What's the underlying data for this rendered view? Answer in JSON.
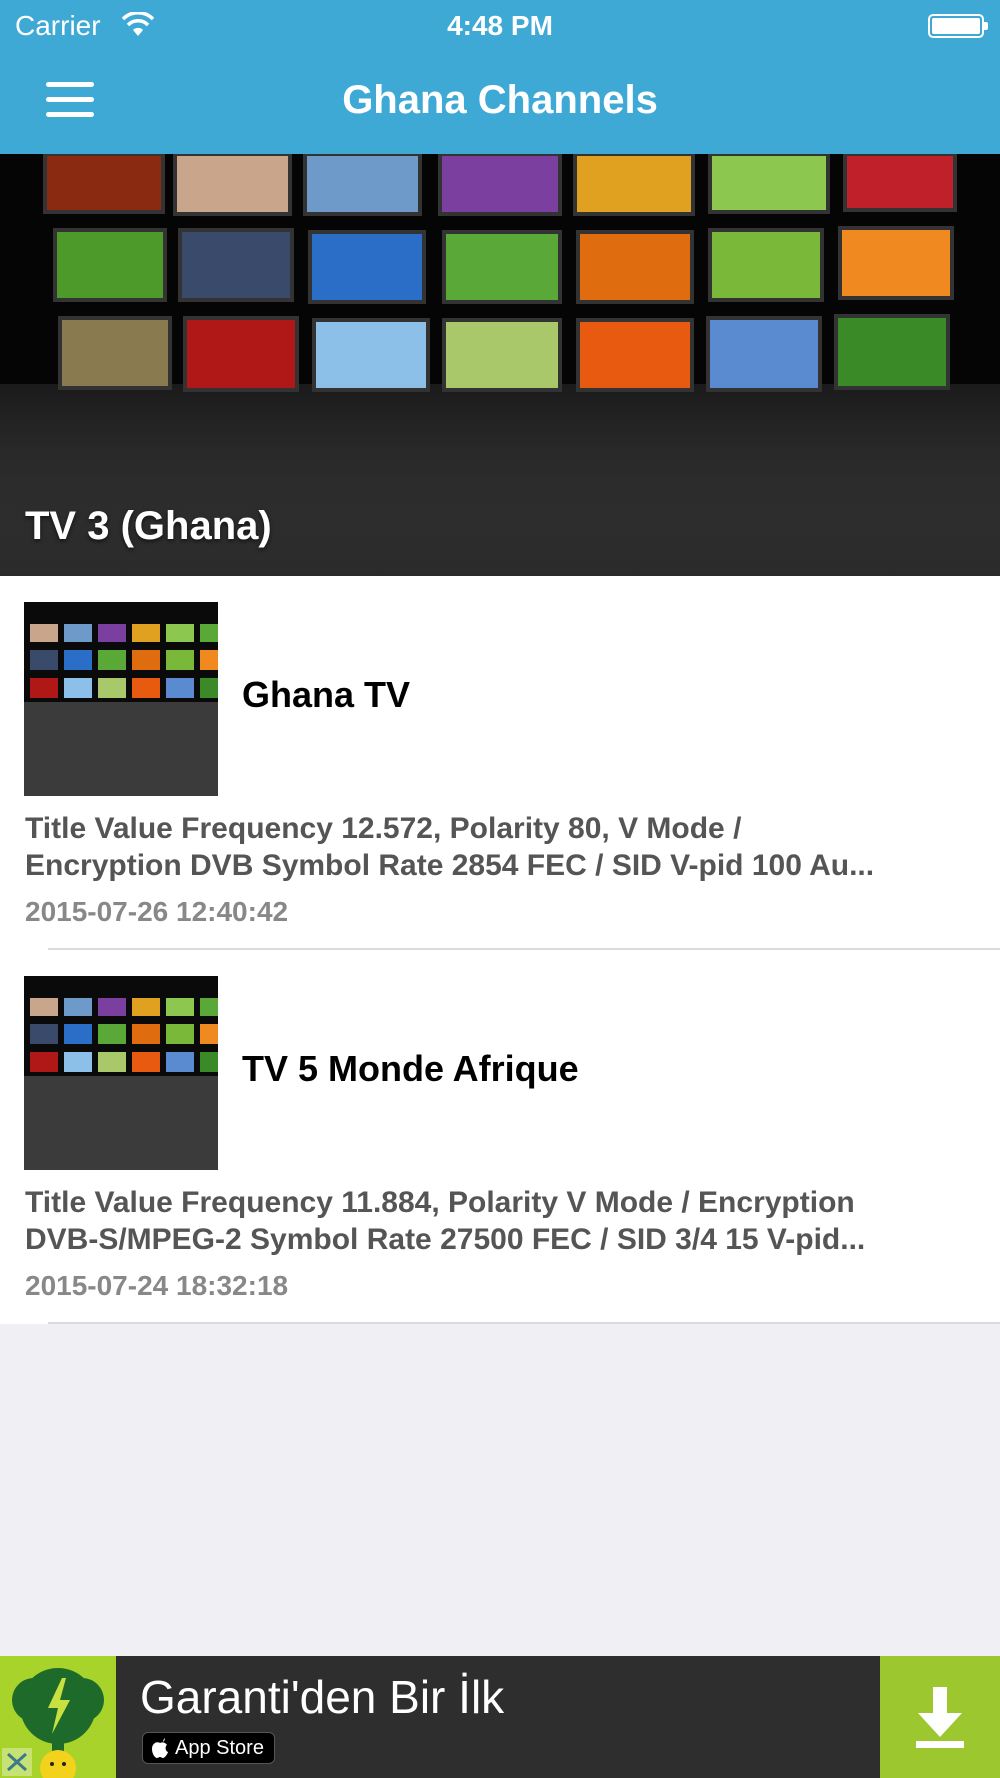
{
  "status_bar": {
    "carrier": "Carrier",
    "time": "4:48 PM"
  },
  "nav": {
    "title": "Ghana Channels",
    "menu_icon": "hamburger-menu-icon"
  },
  "hero": {
    "title": "TV 3 (Ghana)"
  },
  "channels": [
    {
      "name": "Ghana TV",
      "desc_line1": "Title Value Frequency 12.572,  Polarity 80, V Mode /",
      "desc_line2": "Encryption DVB  Symbol Rate   2854 FEC / SID V-pid 100 Au...",
      "date": "2015-07-26 12:40:42"
    },
    {
      "name": "TV 5 Monde Afrique",
      "desc_line1": "Title Value Frequency 11.884,  Polarity V Mode / Encryption",
      "desc_line2": "DVB-S/MPEG-2  Symbol Rate   27500 FEC / SID 3/4 15 V-pid...",
      "date": "2015-07-24 18:32:18"
    }
  ],
  "ad": {
    "title": "Garanti'den Bir İlk",
    "store_label": "App Store",
    "download_icon": "download-arrow-icon"
  },
  "colors": {
    "nav_bg": "#3fa9d6",
    "ad_bg": "#2e2e2e",
    "ad_accent": "#9dc72e"
  }
}
